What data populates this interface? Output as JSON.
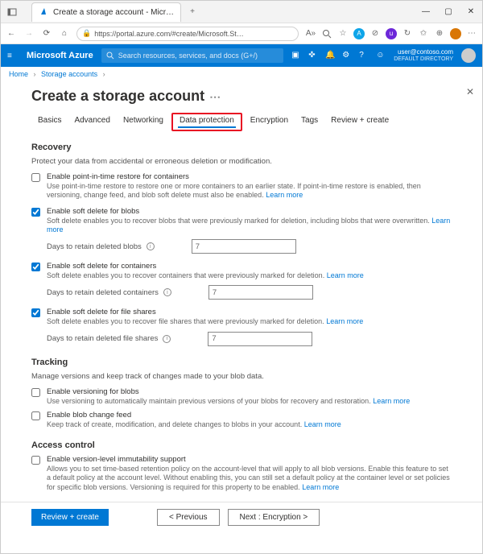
{
  "browser": {
    "tab_title": "Create a storage account - Micr…",
    "url": "https://portal.azure.com/#create/Microsoft.St…"
  },
  "portal": {
    "brand": "Microsoft Azure",
    "search_placeholder": "Search resources, services, and docs (G+/)",
    "user_email": "user@contoso.com",
    "user_directory": "DEFAULT DIRECTORY"
  },
  "breadcrumb": {
    "home": "Home",
    "storage": "Storage accounts"
  },
  "page": {
    "title": "Create a storage account"
  },
  "tabs": {
    "basics": "Basics",
    "advanced": "Advanced",
    "networking": "Networking",
    "data_protection": "Data protection",
    "encryption": "Encryption",
    "tags": "Tags",
    "review": "Review + create"
  },
  "recovery": {
    "title": "Recovery",
    "desc": "Protect your data from accidental or erroneous deletion or modification.",
    "pitr": {
      "label": "Enable point-in-time restore for containers",
      "help": "Use point-in-time restore to restore one or more containers to an earlier state. If point-in-time restore is enabled, then versioning, change feed, and blob soft delete must also be enabled.",
      "learn": "Learn more"
    },
    "blob_sd": {
      "label": "Enable soft delete for blobs",
      "help": "Soft delete enables you to recover blobs that were previously marked for deletion, including blobs that were overwritten.",
      "learn": "Learn more",
      "days_label": "Days to retain deleted blobs",
      "days_value": "7"
    },
    "container_sd": {
      "label": "Enable soft delete for containers",
      "help": "Soft delete enables you to recover containers that were previously marked for deletion.",
      "learn": "Learn more",
      "days_label": "Days to retain deleted containers",
      "days_value": "7"
    },
    "file_sd": {
      "label": "Enable soft delete for file shares",
      "help": "Soft delete enables you to recover file shares that were previously marked for deletion.",
      "learn": "Learn more",
      "days_label": "Days to retain deleted file shares",
      "days_value": "7"
    }
  },
  "tracking": {
    "title": "Tracking",
    "desc": "Manage versions and keep track of changes made to your blob data.",
    "versioning": {
      "label": "Enable versioning for blobs",
      "help": "Use versioning to automatically maintain previous versions of your blobs for recovery and restoration.",
      "learn": "Learn more"
    },
    "change_feed": {
      "label": "Enable blob change feed",
      "help": "Keep track of create, modification, and delete changes to blobs in your account.",
      "learn": "Learn more"
    }
  },
  "access": {
    "title": "Access control",
    "immutability": {
      "label": "Enable version-level immutability support",
      "help": "Allows you to set time-based retention policy on the account-level that will apply to all blob versions. Enable this feature to set a default policy at the account level. Without enabling this, you can still set a default policy at the container level or set policies for specific blob versions. Versioning is required for this property to be enabled.",
      "learn": "Learn more"
    }
  },
  "footer": {
    "review": "Review + create",
    "previous": "< Previous",
    "next": "Next : Encryption >"
  }
}
